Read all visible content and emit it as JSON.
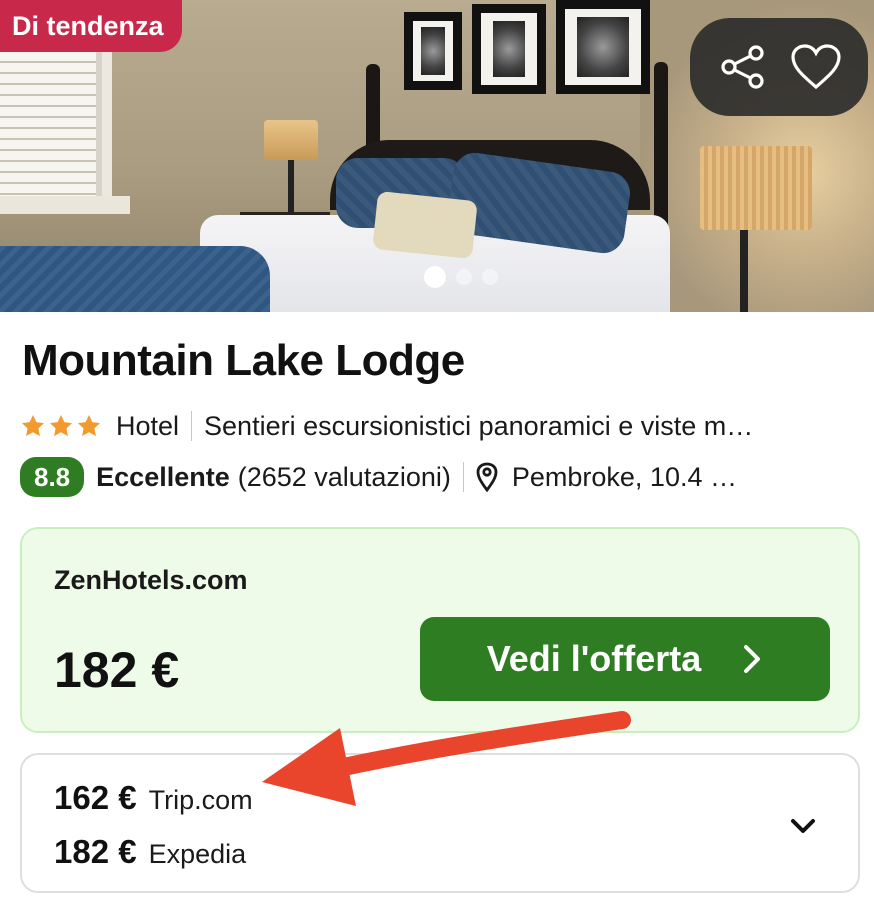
{
  "badge": {
    "label": "Di tendenza"
  },
  "hero": {
    "slide_count": 3,
    "active_slide": 1
  },
  "hotel": {
    "name": "Mountain Lake Lodge",
    "stars": 3,
    "type": "Hotel",
    "highlight": "Sentieri escursionistici panoramici e viste m…",
    "score": "8.8",
    "rating_word": "Eccellente",
    "reviews": "(2652 valutazioni)",
    "location": "Pembroke, 10.4 …"
  },
  "offer": {
    "provider": "ZenHotels.com",
    "price": "182 €",
    "cta_label": "Vedi l'offerta"
  },
  "other_offers": [
    {
      "price": "162 €",
      "provider": "Trip.com"
    },
    {
      "price": "182 €",
      "provider": "Expedia"
    }
  ],
  "colors": {
    "badge_bg": "#c8294b",
    "score_green": "#2e7d22",
    "cta_green": "#2e7d22",
    "offer_bg": "#eefbe9",
    "star_orange": "#f39a2e",
    "annotation_arrow": "#e8452c"
  },
  "icons": [
    "share-icon",
    "heart-icon",
    "star-icon",
    "map-pin-icon",
    "chevron-right-icon",
    "chevron-down-icon"
  ]
}
